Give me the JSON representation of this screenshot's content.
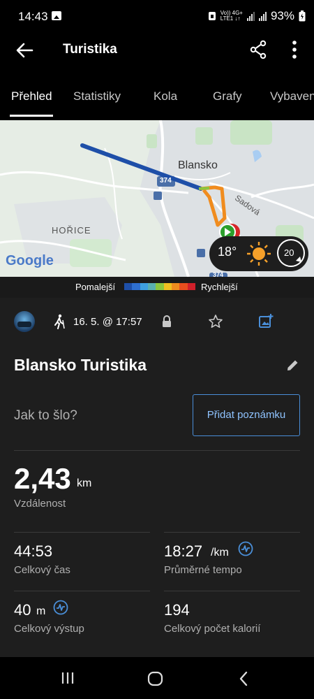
{
  "status_bar": {
    "time": "14:43",
    "net_line1": "Vo)) 4G+",
    "net_line2": "LTE1 ↓↑",
    "battery_percent": "93%"
  },
  "app_bar": {
    "title": "Turistika",
    "back_icon": "arrow-back-icon",
    "share_icon": "share-icon",
    "more_icon": "more-vert-icon"
  },
  "tabs": [
    {
      "label": "Přehled",
      "active": true
    },
    {
      "label": "Statistiky",
      "active": false
    },
    {
      "label": "Kola",
      "active": false
    },
    {
      "label": "Grafy",
      "active": false
    },
    {
      "label": "Vybavení",
      "active": false
    }
  ],
  "map": {
    "city_label": "Blansko",
    "district_label": "HOŘICE",
    "street_label": "Sadová",
    "road_label": "374",
    "road_label_2": "374",
    "logo_text": "Google",
    "weather": {
      "temperature": "18°",
      "wind_speed": "20",
      "icon": "sun-icon"
    }
  },
  "legend": {
    "slower": "Pomalejší",
    "faster": "Rychlejší",
    "colors": [
      "#1e4fa8",
      "#2e6fd0",
      "#3ea0e0",
      "#5ab0b0",
      "#8cc63e",
      "#f0c020",
      "#f08c1e",
      "#e84e1e",
      "#d0202a"
    ]
  },
  "meta": {
    "date": "16. 5. @ 17:57",
    "activity_icon": "hiking-icon"
  },
  "activity": {
    "title": "Blansko Turistika"
  },
  "feedback": {
    "prompt": "Jak to šlo?",
    "add_note_label": "Přidat poznámku"
  },
  "distance": {
    "value": "2,43",
    "unit": "km",
    "label": "Vzdálenost"
  },
  "stats": {
    "total_time": {
      "value": "44:53",
      "label": "Celkový čas"
    },
    "avg_pace": {
      "value": "18:27",
      "unit": "/km",
      "label": "Průměrné tempo"
    },
    "total_ascent": {
      "value": "40",
      "unit": "m",
      "label": "Celkový výstup"
    },
    "total_calories": {
      "value": "194",
      "label": "Celkový počet kalorií"
    }
  },
  "colors": {
    "accent": "#4a8fd9",
    "background": "#1e1e1e",
    "track_start": "#2ca02c",
    "track_end": "#d62728"
  }
}
